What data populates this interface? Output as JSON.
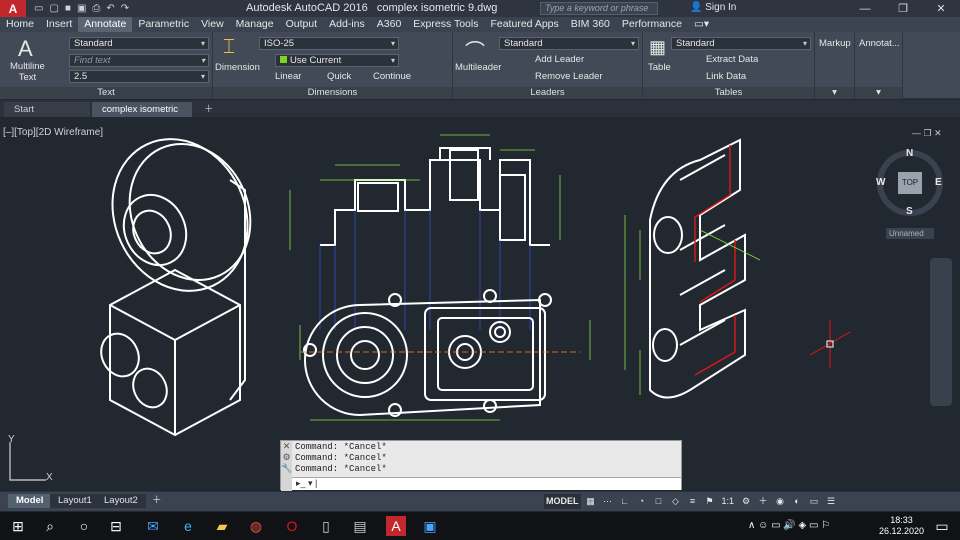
{
  "title_bar": {
    "app_name": "Autodesk AutoCAD 2016",
    "document": "complex isometric 9.dwg",
    "search_placeholder": "Type a keyword or phrase",
    "sign_in": "Sign In"
  },
  "menu": [
    "Home",
    "Insert",
    "Annotate",
    "Parametric",
    "View",
    "Manage",
    "Output",
    "Add-ins",
    "A360",
    "Express Tools",
    "Featured Apps",
    "BIM 360",
    "Performance"
  ],
  "active_menu": "Annotate",
  "ribbon": {
    "text_panel": {
      "title": "Text",
      "big_button": "Multiline\nText",
      "style": "Standard",
      "find_placeholder": "Find text",
      "height": "2.5"
    },
    "dimensions_panel": {
      "title": "Dimensions",
      "big_button": "Dimension",
      "style": "ISO-25",
      "layer": "Use Current",
      "linear": "Linear",
      "quick": "Quick",
      "continue": "Continue"
    },
    "leaders_panel": {
      "title": "Leaders",
      "big_button": "Multileader",
      "style": "Standard",
      "add": "Add Leader",
      "remove": "Remove Leader"
    },
    "tables_panel": {
      "title": "Tables",
      "big_button": "Table",
      "style": "Standard",
      "extract": "Extract Data",
      "link": "Link Data"
    },
    "markup_panel": {
      "title": "Markup"
    },
    "annotation_panel": {
      "title": "Annotat..."
    }
  },
  "doc_tabs": [
    "Start",
    "complex isometric 9*"
  ],
  "viewport": {
    "label": "[–][Top][2D Wireframe]"
  },
  "viewcube": {
    "n": "N",
    "s": "S",
    "e": "E",
    "w": "W",
    "face": "TOP",
    "ucs": "Unnamed"
  },
  "ucs": {
    "x": "X",
    "y": "Y"
  },
  "command_line": {
    "history": [
      "Command: *Cancel*",
      "Command: *Cancel*",
      "Command: *Cancel*"
    ]
  },
  "layout_tabs": [
    "Model",
    "Layout1",
    "Layout2"
  ],
  "status": {
    "model": "MODEL",
    "scale": "1:1"
  },
  "clock": {
    "time": "18:33",
    "date": "26.12.2020"
  },
  "colors": {
    "accent_green": "#7ed321",
    "drawing_white": "#ffffff",
    "dim_green": "#8fe04a",
    "red": "#e01818",
    "blue_proj": "#3a5aff",
    "orange": "#ff8c1a"
  }
}
